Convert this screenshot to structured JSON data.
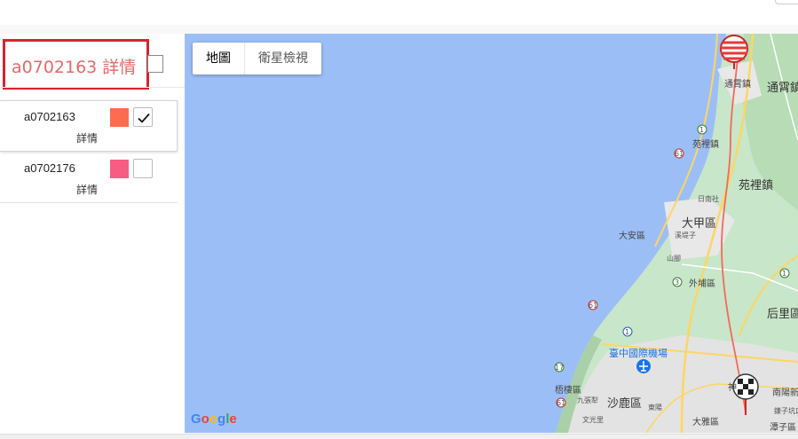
{
  "panel": {
    "title": "a0702163 詳情",
    "vehicles": [
      {
        "id": "a0702163",
        "detail_label": "詳情",
        "color": "#ff6b4f",
        "checked": true
      },
      {
        "id": "a0702176",
        "detail_label": "詳情",
        "color": "#f75c83",
        "checked": false
      }
    ]
  },
  "map": {
    "type_buttons": {
      "map": "地圖",
      "satellite": "衛星檢視"
    },
    "attribution": "Google",
    "route_color": "#f26a5a",
    "places": {
      "tongxiao_1": "通霄鎮",
      "tongxiao_2": "通霄鎮",
      "yuanli_1": "苑裡鎮",
      "yuanli_2": "苑裡鎮",
      "rinan": "日南社",
      "dajia": "大甲區",
      "daan": "大安區",
      "xikang": "溪堤子",
      "shanjiao": "山腳",
      "waipu": "外埔區",
      "houli": "后里區",
      "airport": "臺中國際機場",
      "wuqi": "梧棲區",
      "shalu": "沙鹿區",
      "jiuzhang": "九張犁",
      "wenguang": "文光里",
      "dongyang": "東陽",
      "dadu": "大雅區",
      "nanyang": "南陽新",
      "tanzi": "潭子區",
      "shen": "神",
      "lianzi": "鎌子坑口"
    },
    "routes": {
      "r1": "1",
      "r61": "61",
      "r3": "3",
      "r17": "17",
      "r10": "10",
      "r4": "4"
    }
  }
}
